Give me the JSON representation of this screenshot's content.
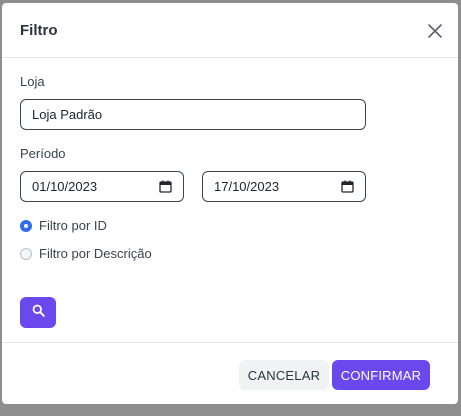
{
  "dialog": {
    "title": "Filtro",
    "close_icon": "close-icon"
  },
  "form": {
    "store_label": "Loja",
    "store_value": "Loja Padrão",
    "period_label": "Período",
    "start_date": "01/10/2023",
    "end_date": "17/10/2023",
    "calendar_icon": "calendar-icon",
    "radio_options": [
      {
        "label": "Filtro por ID",
        "selected": true
      },
      {
        "label": "Filtro por Descrição",
        "selected": false
      }
    ],
    "search_icon": "search-icon"
  },
  "footer": {
    "cancel_label": "CANCELAR",
    "confirm_label": "CONFIRMAR"
  },
  "colors": {
    "accent": "#6b47ee",
    "radio_selected": "#2f6df0",
    "overlay": "#8e8e8e"
  }
}
